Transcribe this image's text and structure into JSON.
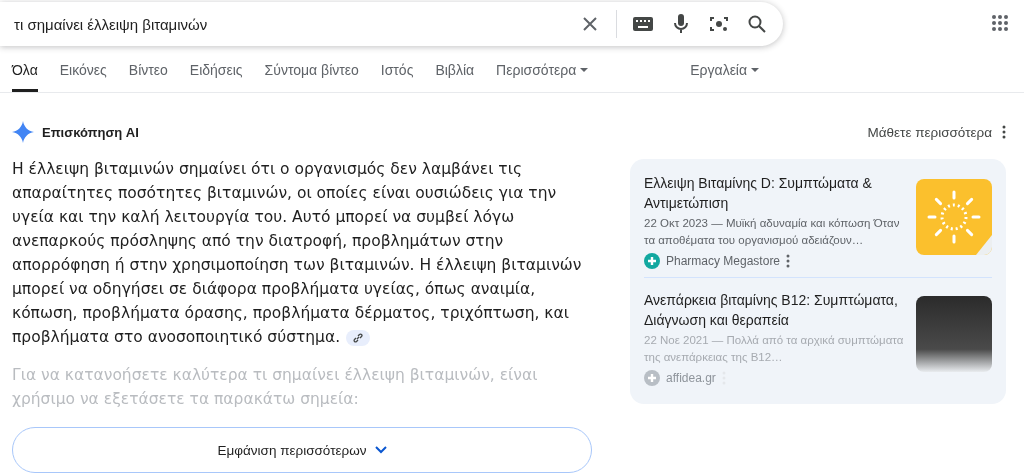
{
  "search": {
    "value": "τι σημαίνει έλλειψη βιταμινών"
  },
  "tabs": [
    {
      "label": "Όλα",
      "selected": true,
      "menu": false
    },
    {
      "label": "Εικόνες",
      "selected": false,
      "menu": false
    },
    {
      "label": "Βίντεο",
      "selected": false,
      "menu": false
    },
    {
      "label": "Ειδήσεις",
      "selected": false,
      "menu": false
    },
    {
      "label": "Σύντομα βίντεο",
      "selected": false,
      "menu": false
    },
    {
      "label": "Ιστός",
      "selected": false,
      "menu": false
    },
    {
      "label": "Βιβλία",
      "selected": false,
      "menu": false
    },
    {
      "label": "Περισσότερα",
      "selected": false,
      "menu": true
    }
  ],
  "tools": {
    "label": "Εργαλεία"
  },
  "ai_overview": {
    "title": "Επισκόπηση AI",
    "learn_more": "Μάθετε περισσότερα",
    "paragraph": "Η έλλειψη βιταμινών σημαίνει ότι ο οργανισμός δεν λαμβάνει τις απαραίτητες ποσότητες βιταμινών, οι οποίες είναι ουσιώδεις για την υγεία και την καλή λειτουργία του. Αυτό μπορεί να συμβεί λόγω ανεπαρκούς πρόσληψης από την διατροφή, προβλημάτων στην απορρόφηση ή στην χρησιμοποίηση των βιταμινών. Η έλλειψη βιταμινών μπορεί να οδηγήσει σε διάφορα προβλήματα υγείας, όπως αναιμία, κόπωση, προβλήματα όρασης, προβλήματα δέρματος, τριχόπτωση, και προβλήματα στο ανοσοποιητικό σύστημα.",
    "faded_paragraph": "Για να κατανοήσετε καλύτερα τι σημαίνει έλλειψη βιταμινών, είναι χρήσιμο να εξετάσετε τα παρακάτω σημεία:",
    "show_more": "Εμφάνιση περισσότερων",
    "sources": [
      {
        "title": "Ελλειψη Βιταμίνης D: Συμπτώματα & Αντιμετώπιση",
        "snippet": "22 Οκτ 2023 — Μυϊκή αδυναμία και κόπωση Όταν τα αποθέματα του οργανισμού αδειάζουν…",
        "source": "Pharmacy Megastore",
        "kind": "sun",
        "faded": false
      },
      {
        "title": "Ανεπάρκεια βιταμίνης B12: Συμπτώματα, Διάγνωση και θεραπεία",
        "snippet": "22 Νοε 2021 — Πολλά από τα αρχικά συμπτώματα της ανεπάρκειας της B12…",
        "source": "affidea.gr",
        "kind": "photo",
        "faded": true
      }
    ]
  }
}
